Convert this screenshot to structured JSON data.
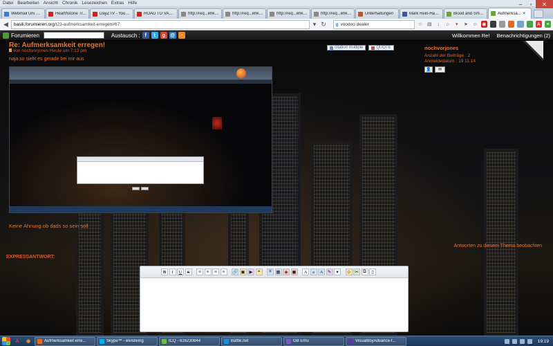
{
  "menu": [
    "Datei",
    "Bearbeiten",
    "Ansicht",
    "Chronik",
    "Lesezeichen",
    "Extras",
    "Hilfe"
  ],
  "tabs": [
    {
      "label": "Webmail Uni Bielef...",
      "color": "#3a7bd5"
    },
    {
      "label": "Hearthstone Tr...",
      "color": "#cc2222"
    },
    {
      "label": "DayZTV - YouT...",
      "color": "#cc2222"
    },
    {
      "label": "ROAD TO VARO...",
      "color": "#cc2222"
    },
    {
      "label": "http://req...ehk_es%21",
      "color": "#888888"
    },
    {
      "label": "http://req...ehk_es%21",
      "color": "#888888"
    },
    {
      "label": "http://req...ehk_es%21",
      "color": "#888888"
    },
    {
      "label": "http://req...ehk_es%21",
      "color": "#888888"
    },
    {
      "label": "Unterhaltungen",
      "color": "#b05a2a"
    },
    {
      "label": "Mark Rein-Hag...",
      "color": "#3b5998"
    },
    {
      "label": "Blood and Smo...",
      "color": "#6aa33a"
    },
    {
      "label": "Aufmerksa...",
      "color": "#6aa33a"
    }
  ],
  "nav": {
    "url_host": "basili.forumieren.org",
    "url_path": "/t23-aufmerksamkeit-erregen#67",
    "search_value": "voodoo dealer"
  },
  "forumbar": {
    "brand": "Forumieren",
    "austausch": "Austausch :",
    "welcome": "Willkommen Re!",
    "notifications": "Benachrichtigungen (2)"
  },
  "post": {
    "title": "Re: Aufmerksamkeit erregen!",
    "meta": "von nochvorjones Heute um 7:13 pm",
    "text1": "naja so sieht es gerade bei mir aus",
    "text2": "Keine Ahnung ob dads so sein soll",
    "quote_multiple": "citation multiple",
    "quote": "QUOTE"
  },
  "author": {
    "name": "nochvorjones",
    "posts": "Anzahl der Beiträge : 2",
    "registered": "Anmeldedatum : 19.11.14"
  },
  "watch_link": "Antworten zu diesem Thema beobachten",
  "express_label": "EXPRESSANTWORT:",
  "editor_buttons": [
    "B",
    "I",
    "U",
    "S"
  ],
  "taskbar": {
    "tasks": [
      {
        "label": "Aufmerksamkeit erre...",
        "color": "#e86a1a"
      },
      {
        "label": "Skype™ - elvisliving",
        "color": "#00aff0"
      },
      {
        "label": "ICQ - 616230844",
        "color": "#6cc04a"
      },
      {
        "label": "Battle.net",
        "color": "#1a8ed6"
      },
      {
        "label": "GB Emu",
        "color": "#7a5cc0"
      },
      {
        "label": "VisualBoyAdvance-f...",
        "color": "#5a3aa0"
      }
    ],
    "clock": "19:19"
  }
}
